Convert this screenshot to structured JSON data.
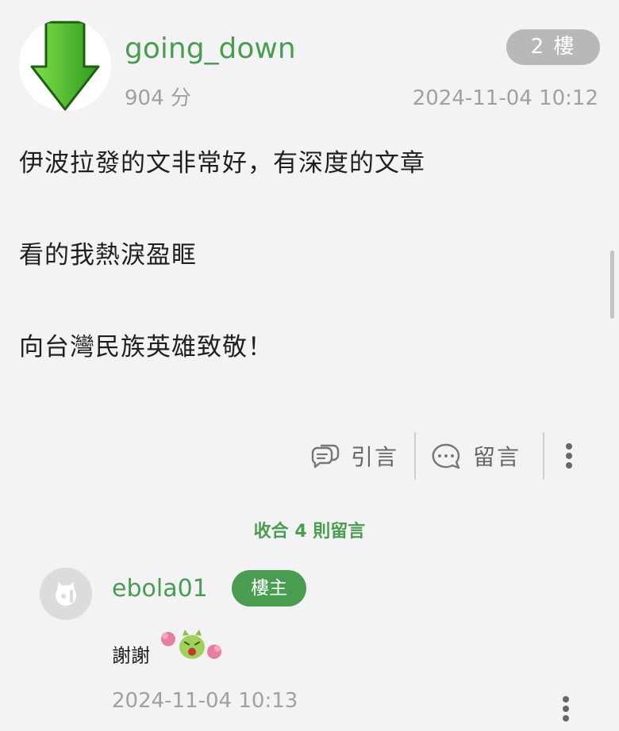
{
  "post": {
    "author": "going_down",
    "score": "904 分",
    "floor": "2 樓",
    "time": "2024-11-04 10:12",
    "avatar_icon": "down-arrow-icon",
    "body_lines": [
      "伊波拉發的文非常好，有深度的文章",
      "看的我熱淚盈眶",
      "向台灣民族英雄致敬！"
    ]
  },
  "actions": {
    "quote_label": "引言",
    "comment_label": "留言",
    "quote_icon": "quote-bubble-icon",
    "comment_icon": "comment-bubble-icon",
    "more_icon": "more-vertical-icon"
  },
  "comments_section": {
    "collapse_label": "收合 4 則留言"
  },
  "comment": {
    "author": "ebola01",
    "badge": "樓主",
    "text": "謝謝",
    "time": "2024-11-04 10:13",
    "sticker_icon": "cheering-sticker-icon"
  },
  "colors": {
    "accent_green": "#4a9d50",
    "muted_text": "#a0a0a0",
    "badge_gray": "#b8b8b8",
    "background": "#f3f3f6"
  }
}
